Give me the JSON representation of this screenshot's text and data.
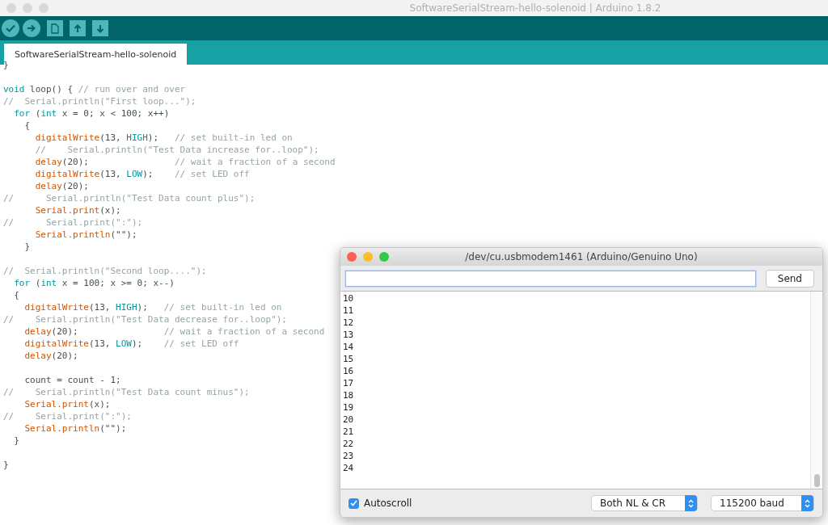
{
  "window": {
    "title": "SoftwareSerialStream-hello-solenoid | Arduino 1.8.2"
  },
  "tabs": [
    {
      "label": "SoftwareSerialStream-hello-solenoid",
      "selected": true
    }
  ],
  "editor": {
    "lines": [
      {
        "kind": "code",
        "segments": [
          {
            "kind": "plain",
            "text": "}"
          }
        ]
      },
      {
        "kind": "blank"
      },
      {
        "kind": "code",
        "segments": [
          {
            "kind": "keyword",
            "text": "void"
          },
          {
            "kind": "plain",
            "text": " loop() { "
          },
          {
            "kind": "comment",
            "text": "// run over and over"
          }
        ]
      },
      {
        "kind": "code",
        "segments": [
          {
            "kind": "comment",
            "text": "//  Serial.println(\"First loop...\");"
          }
        ]
      },
      {
        "kind": "code",
        "segments": [
          {
            "kind": "keyword",
            "text": "  for"
          },
          {
            "kind": "plain",
            "text": " ("
          },
          {
            "kind": "keyword",
            "text": "int"
          },
          {
            "kind": "plain",
            "text": " x = 0; x < 100; x++)"
          }
        ]
      },
      {
        "kind": "code",
        "segments": [
          {
            "kind": "plain",
            "text": "    {"
          }
        ]
      },
      {
        "kind": "code",
        "segments": [
          {
            "kind": "function",
            "text": "      digitalWrite"
          },
          {
            "kind": "plain",
            "text": "(13, "
          },
          {
            "kind": "constant",
            "text": "HIGH"
          },
          {
            "kind": "plain",
            "text": ");   "
          },
          {
            "kind": "comment",
            "text": "// set built-in led on"
          }
        ]
      },
      {
        "kind": "code",
        "segments": [
          {
            "kind": "comment",
            "text": "      //    Serial.println(\"Test Data increase for..loop\");"
          }
        ]
      },
      {
        "kind": "code",
        "segments": [
          {
            "kind": "function",
            "text": "      delay"
          },
          {
            "kind": "plain",
            "text": "(20);                "
          },
          {
            "kind": "comment",
            "text": "// wait a fraction of a second"
          }
        ]
      },
      {
        "kind": "code",
        "segments": [
          {
            "kind": "function",
            "text": "      digitalWrite"
          },
          {
            "kind": "plain",
            "text": "(13, "
          },
          {
            "kind": "constant",
            "text": "LOW"
          },
          {
            "kind": "plain",
            "text": ");    "
          },
          {
            "kind": "comment",
            "text": "// set LED off"
          }
        ]
      },
      {
        "kind": "code",
        "segments": [
          {
            "kind": "function",
            "text": "      delay"
          },
          {
            "kind": "plain",
            "text": "(20);"
          }
        ]
      },
      {
        "kind": "code",
        "segments": [
          {
            "kind": "comment",
            "text": "//      Serial.println(\"Test Data count plus\");"
          }
        ]
      },
      {
        "kind": "code",
        "segments": [
          {
            "kind": "function",
            "text": "      Serial.print"
          },
          {
            "kind": "plain",
            "text": "(x);"
          }
        ]
      },
      {
        "kind": "code",
        "segments": [
          {
            "kind": "comment",
            "text": "//      Serial.print(\":\");"
          }
        ]
      },
      {
        "kind": "code",
        "segments": [
          {
            "kind": "function",
            "text": "      Serial.println"
          },
          {
            "kind": "plain",
            "text": "(\"\");"
          }
        ]
      },
      {
        "kind": "code",
        "segments": [
          {
            "kind": "plain",
            "text": "    }"
          }
        ]
      },
      {
        "kind": "blank"
      },
      {
        "kind": "code",
        "segments": [
          {
            "kind": "comment",
            "text": "//  Serial.println(\"Second loop....\");"
          }
        ]
      },
      {
        "kind": "code",
        "segments": [
          {
            "kind": "keyword",
            "text": "  for"
          },
          {
            "kind": "plain",
            "text": " ("
          },
          {
            "kind": "keyword",
            "text": "int"
          },
          {
            "kind": "plain",
            "text": " x = 100; x >= 0; x--)"
          }
        ]
      },
      {
        "kind": "code",
        "segments": [
          {
            "kind": "plain",
            "text": "  {"
          }
        ]
      },
      {
        "kind": "code",
        "segments": [
          {
            "kind": "function",
            "text": "    digitalWrite"
          },
          {
            "kind": "plain",
            "text": "(13, "
          },
          {
            "kind": "constant",
            "text": "HIGH"
          },
          {
            "kind": "plain",
            "text": ");   "
          },
          {
            "kind": "comment",
            "text": "// set built-in led on"
          }
        ]
      },
      {
        "kind": "code",
        "segments": [
          {
            "kind": "comment",
            "text": "//    Serial.println(\"Test Data decrease for..loop\");"
          }
        ]
      },
      {
        "kind": "code",
        "segments": [
          {
            "kind": "function",
            "text": "    delay"
          },
          {
            "kind": "plain",
            "text": "(20);                "
          },
          {
            "kind": "comment",
            "text": "// wait a fraction of a second"
          }
        ]
      },
      {
        "kind": "code",
        "segments": [
          {
            "kind": "function",
            "text": "    digitalWrite"
          },
          {
            "kind": "plain",
            "text": "(13, "
          },
          {
            "kind": "constant",
            "text": "LOW"
          },
          {
            "kind": "plain",
            "text": ");    "
          },
          {
            "kind": "comment",
            "text": "// set LED off"
          }
        ]
      },
      {
        "kind": "code",
        "segments": [
          {
            "kind": "function",
            "text": "    delay"
          },
          {
            "kind": "plain",
            "text": "(20);"
          }
        ]
      },
      {
        "kind": "blank"
      },
      {
        "kind": "code",
        "segments": [
          {
            "kind": "plain",
            "text": "    count = count - 1;"
          }
        ]
      },
      {
        "kind": "code",
        "segments": [
          {
            "kind": "comment",
            "text": "//    Serial.println(\"Test Data count minus\");"
          }
        ]
      },
      {
        "kind": "code",
        "segments": [
          {
            "kind": "function",
            "text": "    Serial.print"
          },
          {
            "kind": "plain",
            "text": "(x);"
          }
        ]
      },
      {
        "kind": "code",
        "segments": [
          {
            "kind": "comment",
            "text": "//    Serial.print(\":\");"
          }
        ]
      },
      {
        "kind": "code",
        "segments": [
          {
            "kind": "function",
            "text": "    Serial.println"
          },
          {
            "kind": "plain",
            "text": "(\"\");"
          }
        ]
      },
      {
        "kind": "code",
        "segments": [
          {
            "kind": "plain",
            "text": "  }"
          }
        ]
      },
      {
        "kind": "blank"
      },
      {
        "kind": "code",
        "segments": [
          {
            "kind": "plain",
            "text": "}"
          }
        ]
      }
    ]
  },
  "serial_monitor": {
    "title": "/dev/cu.usbmodem1461 (Arduino/Genuino Uno)",
    "send_button": "Send",
    "output_lines": [
      "10",
      "11",
      "12",
      "13",
      "14",
      "15",
      "16",
      "17",
      "18",
      "19",
      "20",
      "21",
      "22",
      "23",
      "24"
    ],
    "autoscroll": {
      "label": "Autoscroll",
      "checked": true
    },
    "line_ending": "Both NL & CR",
    "baud_rate": "115200 baud"
  }
}
